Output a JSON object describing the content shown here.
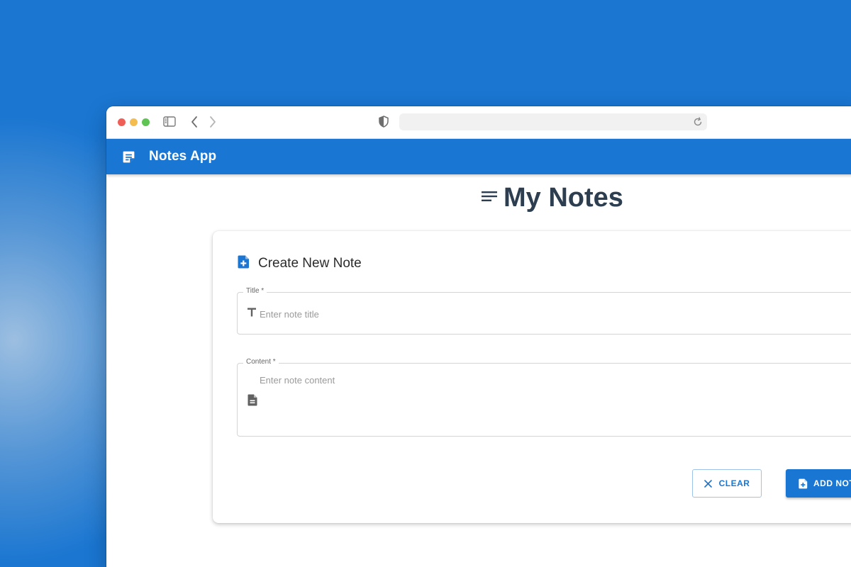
{
  "colors": {
    "desktop_background": "#1a76d1",
    "app_bar": "#1976d2",
    "heading_text": "#2c3e50",
    "primary": "#1976d2"
  },
  "browser": {
    "icons": [
      "sidebar-toggle-icon",
      "back-icon",
      "forward-icon",
      "shield-icon",
      "reload-icon"
    ],
    "address": ""
  },
  "app_bar": {
    "logo_icon": "sticky-note-icon",
    "title": "Notes App"
  },
  "page": {
    "heading_icon": "lines-icon",
    "heading": "My Notes"
  },
  "form": {
    "header_icon": "note-add-icon",
    "title": "Create New Note",
    "title_field": {
      "label": "Title *",
      "placeholder": "Enter note title",
      "value": "",
      "icon": "text-format-icon"
    },
    "content_field": {
      "label": "Content *",
      "placeholder": "Enter note content",
      "value": "",
      "icon": "document-icon"
    },
    "clear_button": {
      "label": "CLEAR",
      "icon": "close-icon"
    },
    "add_button": {
      "label": "ADD NOTE",
      "icon": "note-add-icon"
    }
  }
}
